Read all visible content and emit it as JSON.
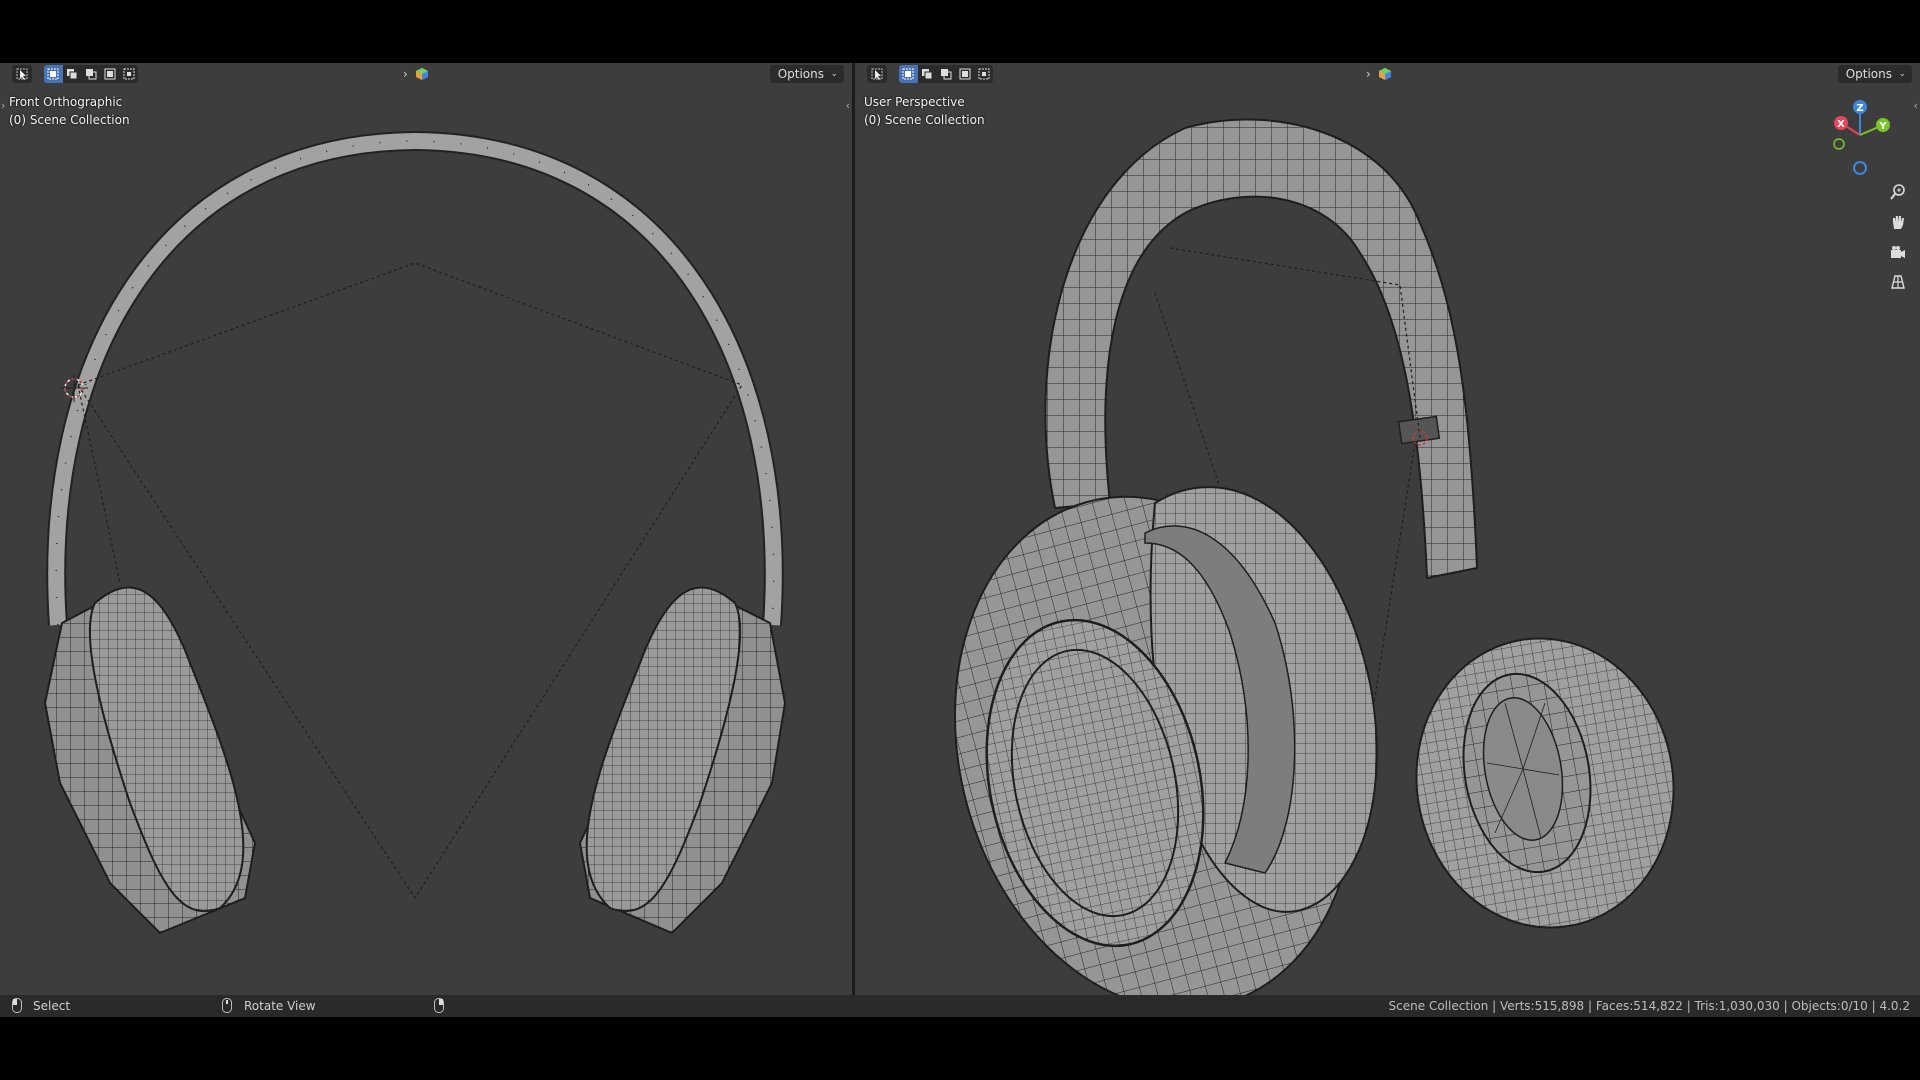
{
  "left_viewport": {
    "view_name": "Front Orthographic",
    "collection": "(0) Scene Collection",
    "options_label": "Options"
  },
  "right_viewport": {
    "view_name": "User Perspective",
    "collection": "(0) Scene Collection",
    "options_label": "Options",
    "gizmo": {
      "x_label": "X",
      "y_label": "Y",
      "z_label": "Z",
      "x_color": "#e8435a",
      "y_color": "#79c42a",
      "z_color": "#3f86e0"
    }
  },
  "status_bar": {
    "select_label": "Select",
    "rotate_label": "Rotate View",
    "stats": "Scene Collection | Verts:515,898 | Faces:514,822 | Tris:1,030,030 | Objects:0/10 | 4.0.2"
  },
  "colors": {
    "viewport_bg": "#3d3d3d",
    "header_button_bg": "#2b2b2b",
    "active_select": "#4772b3",
    "mesh_fill": "#8f8f8f",
    "wire": "#1e1e1e"
  },
  "icons": {
    "mode": "cursor-select-icon",
    "select_modes": [
      "select-new-icon",
      "select-extend-icon",
      "select-subtract-icon",
      "select-invert-icon",
      "select-intersect-icon"
    ],
    "nav": [
      "zoom-icon",
      "pan-hand-icon",
      "camera-icon",
      "ortho-grid-icon"
    ],
    "status": [
      "mouse-left-icon",
      "mouse-middle-icon",
      "mouse-right-icon"
    ]
  }
}
